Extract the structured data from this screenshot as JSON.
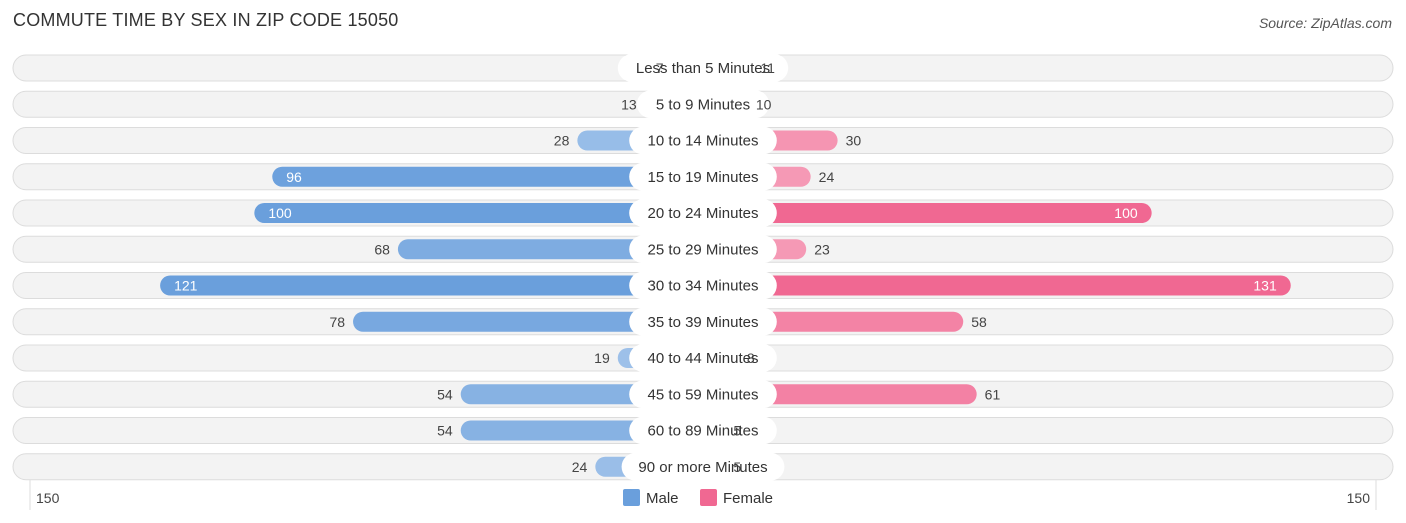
{
  "header": {
    "title": "COMMUTE TIME BY SEX IN ZIP CODE 15050",
    "source": "Source: ZipAtlas.com"
  },
  "chart_data": {
    "type": "bar",
    "orientation": "horizontal-diverging",
    "title": "COMMUTE TIME BY SEX IN ZIP CODE 15050",
    "categories": [
      "Less than 5 Minutes",
      "5 to 9 Minutes",
      "10 to 14 Minutes",
      "15 to 19 Minutes",
      "20 to 24 Minutes",
      "25 to 29 Minutes",
      "30 to 34 Minutes",
      "35 to 39 Minutes",
      "40 to 44 Minutes",
      "45 to 59 Minutes",
      "60 to 89 Minutes",
      "90 or more Minutes"
    ],
    "series": [
      {
        "name": "Male",
        "side": "left",
        "color": "#6a9fdc",
        "light_color": "#a9c8ec",
        "values": [
          7,
          13,
          28,
          96,
          100,
          68,
          121,
          78,
          19,
          54,
          54,
          24
        ]
      },
      {
        "name": "Female",
        "side": "right",
        "color": "#f06892",
        "light_color": "#f7a8c0",
        "values": [
          11,
          10,
          30,
          24,
          100,
          23,
          131,
          58,
          8,
          61,
          5,
          5
        ]
      }
    ],
    "axis": {
      "left_max_label": "150",
      "right_max_label": "150",
      "max": 150
    },
    "legend": {
      "position": "bottom-center",
      "items": [
        "Male",
        "Female"
      ]
    }
  }
}
